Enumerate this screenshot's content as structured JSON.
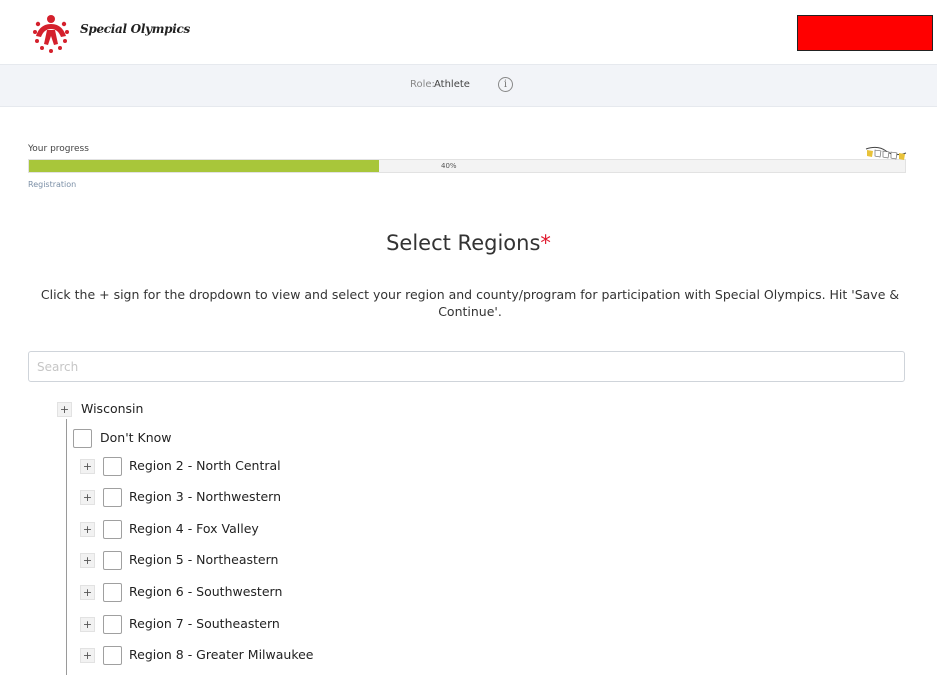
{
  "header": {
    "logo_text": "Special Olympics"
  },
  "rolebar": {
    "label": "Role:",
    "value": "Athlete"
  },
  "progress": {
    "label": "Your progress",
    "percent_text": "40%",
    "fraction": 0.4,
    "step": "Registration",
    "fill_color": "#a8c63a"
  },
  "main": {
    "title": "Select Regions",
    "required_mark": "*",
    "instructions": "Click the + sign for the dropdown to view and select your region and county/program for participation with Special Olympics. Hit 'Save & Continue'.",
    "search_placeholder": "Search"
  },
  "tree": {
    "root": {
      "expand_symbol": "+",
      "label": "Wisconsin"
    },
    "dont_know": "Don't Know",
    "regions": [
      {
        "expand_symbol": "+",
        "label": "Region 2 - North Central"
      },
      {
        "expand_symbol": "+",
        "label": "Region 3 - Northwestern"
      },
      {
        "expand_symbol": "+",
        "label": "Region 4 - Fox Valley"
      },
      {
        "expand_symbol": "+",
        "label": "Region 5 - Northeastern"
      },
      {
        "expand_symbol": "+",
        "label": "Region 6 - Southwestern"
      },
      {
        "expand_symbol": "+",
        "label": "Region 7 - Southeastern"
      },
      {
        "expand_symbol": "+",
        "label": "Region 8 - Greater Milwaukee"
      }
    ]
  },
  "colors": {
    "accent_green": "#a8c63a",
    "required_red": "#e0182d",
    "redaction": "#ff0000"
  }
}
